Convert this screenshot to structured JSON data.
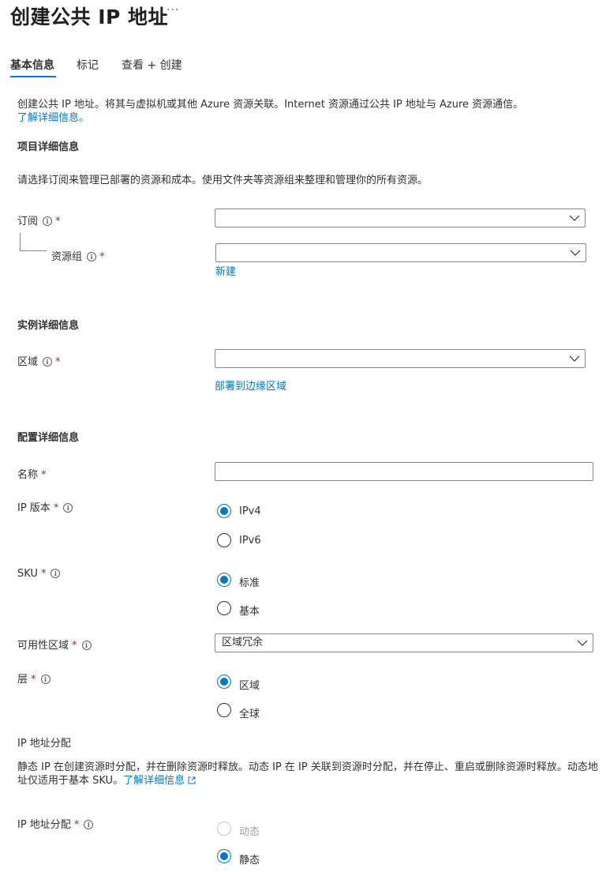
{
  "page": {
    "title": "创建公共 IP 地址",
    "more": "···"
  },
  "tabs": [
    "基本信息",
    "标记",
    "查看 + 创建"
  ],
  "intro": {
    "text": "创建公共 IP 地址。将其与虚拟机或其他 Azure 资源关联。Internet 资源通过公共 IP 地址与 Azure 资源通信。",
    "link": "了解详细信息。"
  },
  "project": {
    "heading": "项目详细信息",
    "desc": "请选择订阅来管理已部署的资源和成本。使用文件夹等资源组来整理和管理你的所有资源。",
    "subscription_label": "订阅",
    "subscription_value": "",
    "resource_group_label": "资源组",
    "resource_group_value": "",
    "new_link": "新建"
  },
  "instance": {
    "heading": "实例详细信息",
    "region_label": "区域",
    "region_value": "",
    "edge_link": "部署到边缘区域"
  },
  "config": {
    "heading": "配置详细信息",
    "name_label": "名称",
    "name_value": "",
    "ip_version_label": "IP 版本",
    "ip_version_options": [
      "IPv4",
      "IPv6"
    ],
    "ip_version_selected": "IPv4",
    "sku_label": "SKU",
    "sku_options": [
      "标准",
      "基本"
    ],
    "sku_selected": "标准",
    "az_label": "可用性区域",
    "az_value": "区域冗余",
    "tier_label": "层",
    "tier_options": [
      "区域",
      "全球"
    ],
    "tier_selected": "区域"
  },
  "assignment": {
    "heading": "IP 地址分配",
    "desc": "静态 IP 在创建资源时分配，并在删除资源时释放。动态 IP 在 IP 关联到资源时分配，并在停止、重启或删除资源时释放。动态地址仅适用于基本 SKU。",
    "link": "了解详细信息",
    "label": "IP 地址分配",
    "options": [
      "动态",
      "静态"
    ],
    "selected": "静态"
  },
  "required_mark": "*",
  "info_glyph": "i",
  "colors": {
    "accent": "#0078d4",
    "required": "#a4262c",
    "border": "#8a8886"
  }
}
